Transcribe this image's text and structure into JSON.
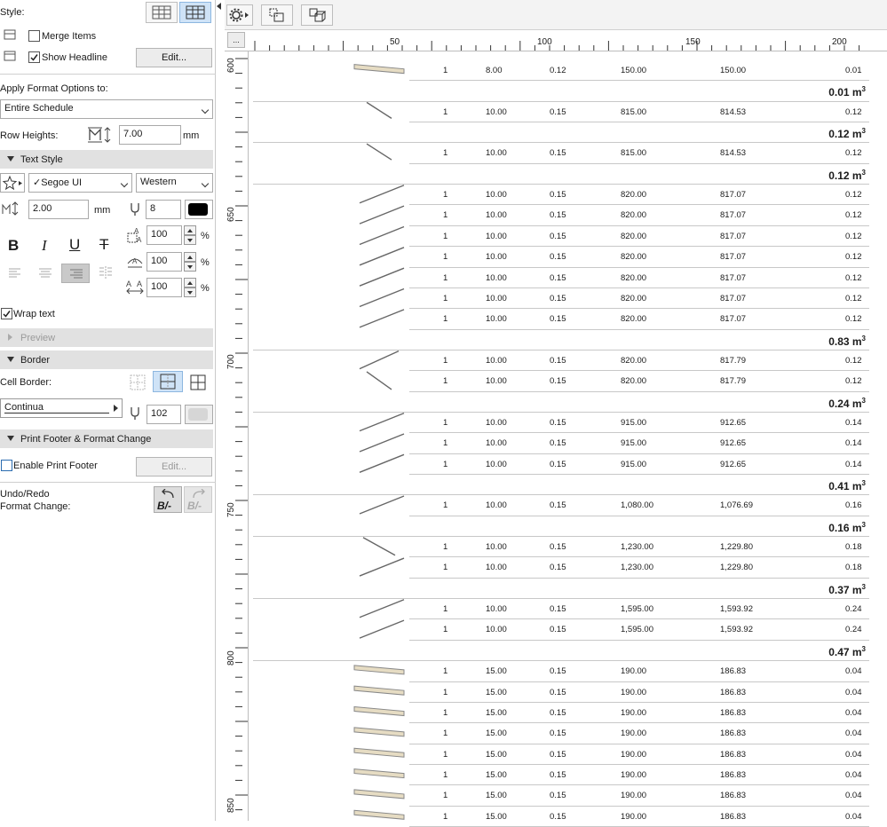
{
  "left_panel": {
    "style_label": "Style:",
    "merge_items": "Merge Items",
    "show_headline": "Show Headline",
    "edit_label": "Edit...",
    "apply_label": "Apply Format Options to:",
    "apply_value": "Entire Schedule",
    "row_heights_label": "Row Heights:",
    "row_heights_value": "7.00",
    "row_heights_unit": "mm",
    "text_style_section": "Text Style",
    "font_value": "✓Segoe UI",
    "script_value": "Western",
    "text_size_value": "2.00",
    "text_size_unit": "mm",
    "pen_value": "8",
    "bold_label": "B",
    "italic_label": "I",
    "underline_label": "U",
    "strike_label": "T",
    "width_factor": "100",
    "spacing_factor": "100",
    "char_spacing": "100",
    "percent": "%",
    "wrap_text": "Wrap text",
    "preview_section": "Preview",
    "border_section": "Border",
    "cell_border_label": "Cell Border:",
    "line_type": "Continua",
    "border_pen": "102",
    "footer_section": "Print Footer & Format Change",
    "enable_footer": "Enable Print Footer",
    "footer_edit": "Edit...",
    "undo_label_1": "Undo/Redo",
    "undo_label_2": "Format Change:",
    "undo_glyph": "B/-",
    "redo_glyph": "B/-",
    "wrap_checked": true,
    "show_headline_checked": true,
    "merge_items_checked": false,
    "enable_footer_checked": false
  },
  "toolbar": {
    "ruler_button": "..."
  },
  "ruler": {
    "top_labels": [
      "50",
      "100",
      "150",
      "200"
    ],
    "left_labels": [
      "600",
      "650",
      "700",
      "750",
      "800",
      "850"
    ]
  },
  "rows": [
    {
      "type": "data",
      "qty": "1",
      "a": "8.00",
      "b": "0.12",
      "c": "150.00",
      "d": "150.00",
      "e": "0.01"
    },
    {
      "type": "total",
      "value": "0.01 m",
      "sup": "3"
    },
    {
      "type": "data",
      "qty": "1",
      "a": "10.00",
      "b": "0.15",
      "c": "815.00",
      "d": "814.53",
      "e": "0.12"
    },
    {
      "type": "total",
      "value": "0.12 m",
      "sup": "3"
    },
    {
      "type": "data",
      "qty": "1",
      "a": "10.00",
      "b": "0.15",
      "c": "815.00",
      "d": "814.53",
      "e": "0.12"
    },
    {
      "type": "total",
      "value": "0.12 m",
      "sup": "3"
    },
    {
      "type": "data",
      "qty": "1",
      "a": "10.00",
      "b": "0.15",
      "c": "820.00",
      "d": "817.07",
      "e": "0.12"
    },
    {
      "type": "data",
      "qty": "1",
      "a": "10.00",
      "b": "0.15",
      "c": "820.00",
      "d": "817.07",
      "e": "0.12"
    },
    {
      "type": "data",
      "qty": "1",
      "a": "10.00",
      "b": "0.15",
      "c": "820.00",
      "d": "817.07",
      "e": "0.12"
    },
    {
      "type": "data",
      "qty": "1",
      "a": "10.00",
      "b": "0.15",
      "c": "820.00",
      "d": "817.07",
      "e": "0.12"
    },
    {
      "type": "data",
      "qty": "1",
      "a": "10.00",
      "b": "0.15",
      "c": "820.00",
      "d": "817.07",
      "e": "0.12"
    },
    {
      "type": "data",
      "qty": "1",
      "a": "10.00",
      "b": "0.15",
      "c": "820.00",
      "d": "817.07",
      "e": "0.12"
    },
    {
      "type": "data",
      "qty": "1",
      "a": "10.00",
      "b": "0.15",
      "c": "820.00",
      "d": "817.07",
      "e": "0.12"
    },
    {
      "type": "total",
      "value": "0.83 m",
      "sup": "3"
    },
    {
      "type": "data",
      "qty": "1",
      "a": "10.00",
      "b": "0.15",
      "c": "820.00",
      "d": "817.79",
      "e": "0.12"
    },
    {
      "type": "data",
      "qty": "1",
      "a": "10.00",
      "b": "0.15",
      "c": "820.00",
      "d": "817.79",
      "e": "0.12"
    },
    {
      "type": "total",
      "value": "0.24 m",
      "sup": "3"
    },
    {
      "type": "data",
      "qty": "1",
      "a": "10.00",
      "b": "0.15",
      "c": "915.00",
      "d": "912.65",
      "e": "0.14"
    },
    {
      "type": "data",
      "qty": "1",
      "a": "10.00",
      "b": "0.15",
      "c": "915.00",
      "d": "912.65",
      "e": "0.14"
    },
    {
      "type": "data",
      "qty": "1",
      "a": "10.00",
      "b": "0.15",
      "c": "915.00",
      "d": "912.65",
      "e": "0.14"
    },
    {
      "type": "total",
      "value": "0.41 m",
      "sup": "3"
    },
    {
      "type": "data",
      "qty": "1",
      "a": "10.00",
      "b": "0.15",
      "c": "1,080.00",
      "d": "1,076.69",
      "e": "0.16"
    },
    {
      "type": "total",
      "value": "0.16 m",
      "sup": "3"
    },
    {
      "type": "data",
      "qty": "1",
      "a": "10.00",
      "b": "0.15",
      "c": "1,230.00",
      "d": "1,229.80",
      "e": "0.18"
    },
    {
      "type": "data",
      "qty": "1",
      "a": "10.00",
      "b": "0.15",
      "c": "1,230.00",
      "d": "1,229.80",
      "e": "0.18"
    },
    {
      "type": "total",
      "value": "0.37 m",
      "sup": "3"
    },
    {
      "type": "data",
      "qty": "1",
      "a": "10.00",
      "b": "0.15",
      "c": "1,595.00",
      "d": "1,593.92",
      "e": "0.24"
    },
    {
      "type": "data",
      "qty": "1",
      "a": "10.00",
      "b": "0.15",
      "c": "1,595.00",
      "d": "1,593.92",
      "e": "0.24"
    },
    {
      "type": "total",
      "value": "0.47 m",
      "sup": "3"
    },
    {
      "type": "data",
      "qty": "1",
      "a": "15.00",
      "b": "0.15",
      "c": "190.00",
      "d": "186.83",
      "e": "0.04"
    },
    {
      "type": "data",
      "qty": "1",
      "a": "15.00",
      "b": "0.15",
      "c": "190.00",
      "d": "186.83",
      "e": "0.04"
    },
    {
      "type": "data",
      "qty": "1",
      "a": "15.00",
      "b": "0.15",
      "c": "190.00",
      "d": "186.83",
      "e": "0.04"
    },
    {
      "type": "data",
      "qty": "1",
      "a": "15.00",
      "b": "0.15",
      "c": "190.00",
      "d": "186.83",
      "e": "0.04"
    },
    {
      "type": "data",
      "qty": "1",
      "a": "15.00",
      "b": "0.15",
      "c": "190.00",
      "d": "186.83",
      "e": "0.04"
    },
    {
      "type": "data",
      "qty": "1",
      "a": "15.00",
      "b": "0.15",
      "c": "190.00",
      "d": "186.83",
      "e": "0.04"
    },
    {
      "type": "data",
      "qty": "1",
      "a": "15.00",
      "b": "0.15",
      "c": "190.00",
      "d": "186.83",
      "e": "0.04"
    },
    {
      "type": "data",
      "qty": "1",
      "a": "15.00",
      "b": "0.15",
      "c": "190.00",
      "d": "186.83",
      "e": "0.04"
    }
  ],
  "colors": {
    "selected_bg": "#cfe3f7",
    "section_bg": "#e1e1e1",
    "beam_fill": "#e6dcc3"
  }
}
